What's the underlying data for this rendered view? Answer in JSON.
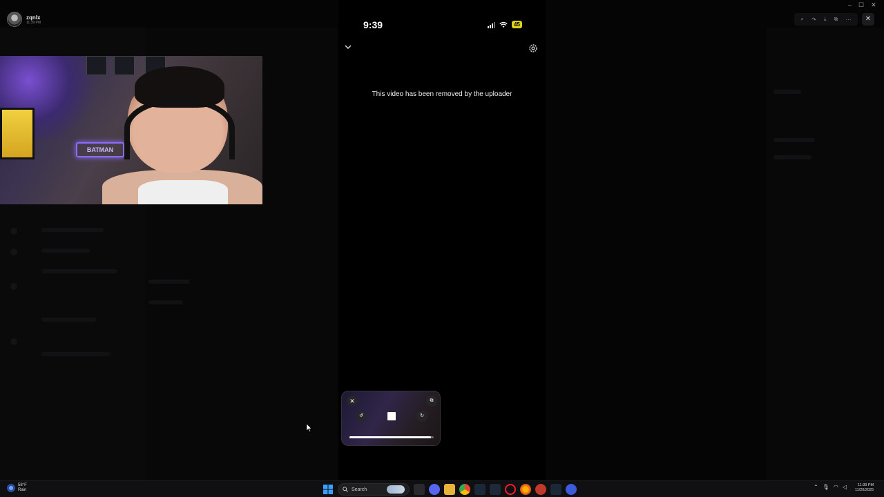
{
  "user": {
    "name": "zqnlx",
    "time": "11:39 PM"
  },
  "phone": {
    "time": "9:39",
    "battery": "45",
    "message": "This video has been removed by the uploader"
  },
  "webcam": {
    "sign_text": "BATMAN"
  },
  "pip": {
    "progress": 0.97
  },
  "window": {
    "minimize": "–",
    "maximize": "☐",
    "close": "✕"
  },
  "toolbar": {
    "icons": [
      "zoom-icon",
      "share-icon",
      "download-icon",
      "popout-icon",
      "more-icon"
    ],
    "close": "✕"
  },
  "taskbar": {
    "weather_temp": "58°F",
    "weather_cond": "Rain",
    "search_label": "Search",
    "clock_time": "11:39 PM",
    "clock_date": "11/20/2025"
  },
  "colors": {
    "battery": "#e0d21c",
    "accent": "#8a6cff"
  }
}
